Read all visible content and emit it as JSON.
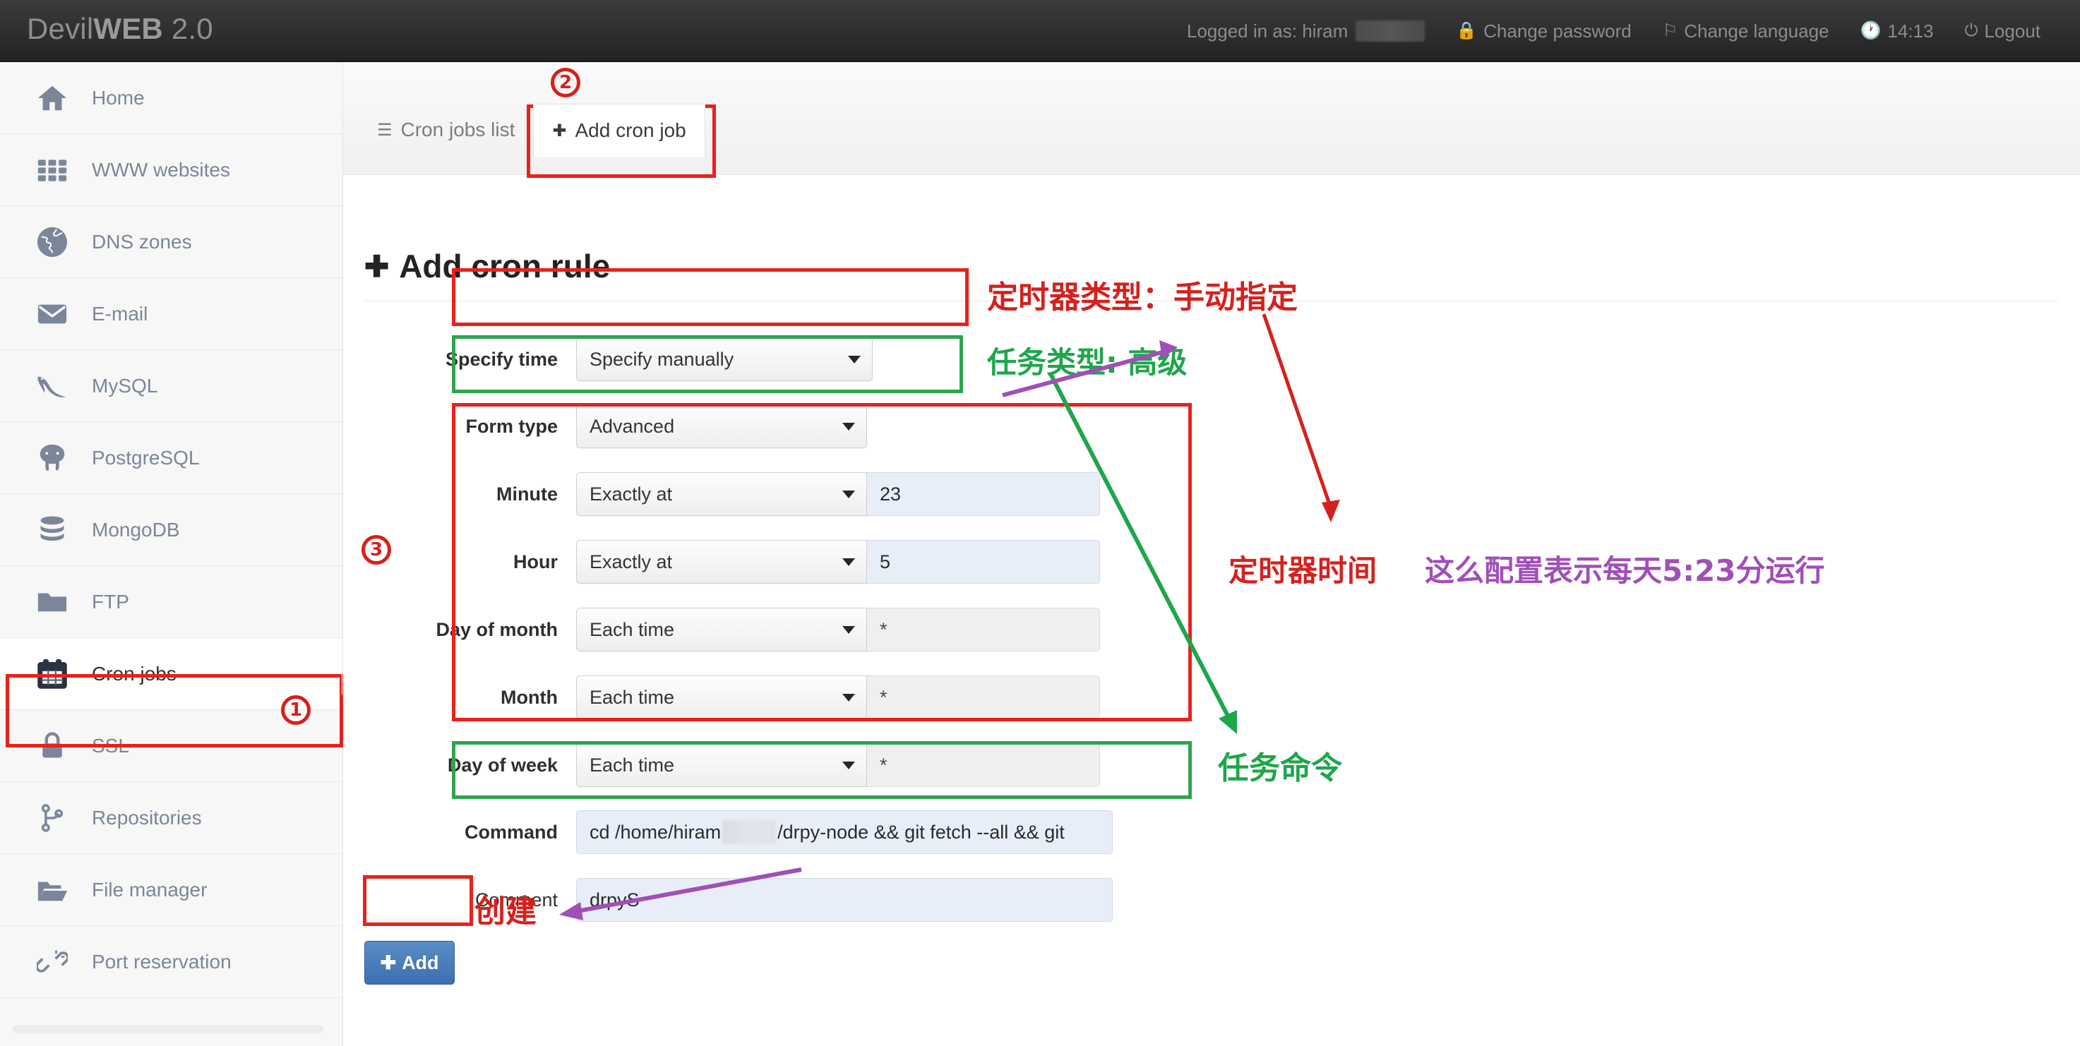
{
  "header": {
    "brand_regular": "Devil",
    "brand_bold": "WEB",
    "brand_version": " 2.0",
    "logged_in_label": "Logged in as: hiram",
    "change_password": "Change password",
    "change_language": "Change language",
    "clock": "14:13",
    "logout": "Logout",
    "icons": {
      "lock": "lock-icon",
      "flag": "flag-icon",
      "clock": "clock-icon",
      "power": "power-icon"
    }
  },
  "sidebar": {
    "items": [
      {
        "label": "Home",
        "icon": "home-icon",
        "active": false
      },
      {
        "label": "WWW websites",
        "icon": "grid-icon",
        "active": false
      },
      {
        "label": "DNS zones",
        "icon": "globe-icon",
        "active": false
      },
      {
        "label": "E-mail",
        "icon": "envelope-icon",
        "active": false
      },
      {
        "label": "MySQL",
        "icon": "dolphin-icon",
        "active": false
      },
      {
        "label": "PostgreSQL",
        "icon": "elephant-icon",
        "active": false
      },
      {
        "label": "MongoDB",
        "icon": "database-icon",
        "active": false
      },
      {
        "label": "FTP",
        "icon": "folder-icon",
        "active": false
      },
      {
        "label": "Cron jobs",
        "icon": "calendar-icon",
        "active": true,
        "badge": "1"
      },
      {
        "label": "SSL",
        "icon": "padlock-icon",
        "active": false
      },
      {
        "label": "Repositories",
        "icon": "code-branch-icon",
        "active": false
      },
      {
        "label": "File manager",
        "icon": "folder-open-icon",
        "active": false
      },
      {
        "label": "Port reservation",
        "icon": "broken-chain-icon",
        "active": false
      }
    ]
  },
  "tabs": [
    {
      "label": "Cron jobs list",
      "icon": "list-icon",
      "active": false
    },
    {
      "label": "Add cron job",
      "icon": "plus-icon",
      "active": true,
      "badge": "2"
    }
  ],
  "page": {
    "title": "Add cron rule",
    "title_icon": "plus-icon"
  },
  "form": {
    "rows": [
      {
        "label": "Specify time",
        "select": "Specify manually",
        "value": null,
        "value_state": "none"
      },
      {
        "label": "Form type",
        "select": "Advanced",
        "value": null,
        "value_state": "none"
      },
      {
        "label": "Minute",
        "select": "Exactly at",
        "value": "23",
        "value_state": "active"
      },
      {
        "label": "Hour",
        "select": "Exactly at",
        "value": "5",
        "value_state": "active"
      },
      {
        "label": "Day of month",
        "select": "Each time",
        "value": "*",
        "value_state": "disabled"
      },
      {
        "label": "Month",
        "select": "Each time",
        "value": "*",
        "value_state": "disabled"
      },
      {
        "label": "Day of week",
        "select": "Each time",
        "value": "*",
        "value_state": "disabled"
      }
    ],
    "command": {
      "label": "Command",
      "value_prefix": "cd /home/hiram",
      "value_suffix": "/drpy-node && git fetch --all && git",
      "redacted": true
    },
    "comment": {
      "label": "Comment",
      "value": "drpyS"
    },
    "submit": {
      "label": "Add",
      "icon": "plus-icon"
    }
  },
  "annotations": {
    "markers": [
      {
        "id": "marker-1",
        "text": "1"
      },
      {
        "id": "marker-2",
        "text": "2"
      },
      {
        "id": "marker-3",
        "text": "3"
      }
    ],
    "notes": [
      {
        "id": "note-timer-type",
        "text": "定时器类型：手动指定",
        "color": "#d5211d"
      },
      {
        "id": "note-task-type",
        "text": "任务类型: 高级",
        "color": "#1ea64b"
      },
      {
        "id": "note-timer-time",
        "text": "定时器时间",
        "color": "#d5211d"
      },
      {
        "id": "note-schedule-desc",
        "text": "这么配置表示每天5:23分运行",
        "color": "#a04fb8"
      },
      {
        "id": "note-task-command",
        "text": "任务命令",
        "color": "#1ea64b"
      },
      {
        "id": "note-create",
        "text": "创建",
        "color": "#d5211d"
      }
    ]
  },
  "colors": {
    "highlight_red": "#e8221b",
    "highlight_green": "#2fa44f",
    "accent_blue": "#3d6fae",
    "sidebar_text": "#7b8699"
  }
}
